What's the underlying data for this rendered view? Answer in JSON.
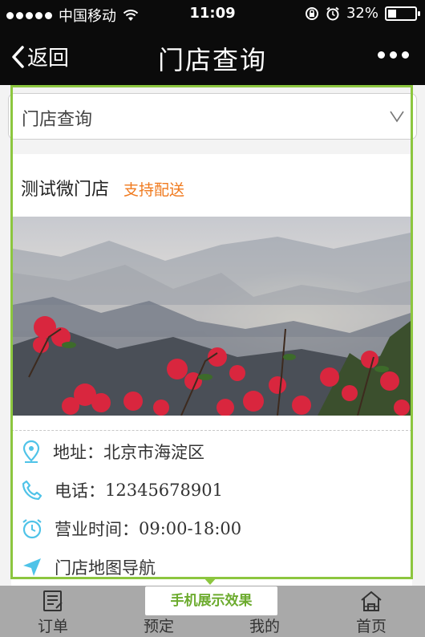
{
  "status_bar": {
    "carrier": "中国移动",
    "time": "11:09",
    "battery": "32%",
    "battery_level": 0.32,
    "icons": [
      "signal-dots",
      "wifi-icon",
      "rotation-lock-icon",
      "alarm-icon",
      "battery-icon"
    ]
  },
  "nav": {
    "back_label": "返回",
    "title": "门店查询",
    "icons": [
      "chevron-left-icon",
      "more-icon"
    ]
  },
  "dropdown": {
    "selected": "门店查询",
    "icon": "chevron-down-icon"
  },
  "store": {
    "name": "测试微门店",
    "tag": "支持配送",
    "image": "mountain-flowers-photo",
    "address_label": "地址：",
    "address_value": "北京市海淀区",
    "phone_label": "电话：",
    "phone_value": "12345678901",
    "hours_label": "营业时间：",
    "hours_value": "09:00-18:00",
    "navigation_label": "门店地图导航",
    "icons": [
      "location-pin-icon",
      "phone-icon",
      "clock-icon",
      "navigate-arrow-icon"
    ]
  },
  "preview_button": "手机展示效果",
  "tabs": [
    {
      "label": "订单",
      "icon": "order-list-icon"
    },
    {
      "label": "预定",
      "icon": "reserve-icon"
    },
    {
      "label": "我的",
      "icon": "user-icon"
    },
    {
      "label": "首页",
      "icon": "home-icon"
    }
  ],
  "colors": {
    "bar_bg": "#0b0b0b",
    "accent_green": "#8cc63f",
    "tag_orange": "#f07a1e",
    "icon_cyan": "#4fc3e8"
  }
}
